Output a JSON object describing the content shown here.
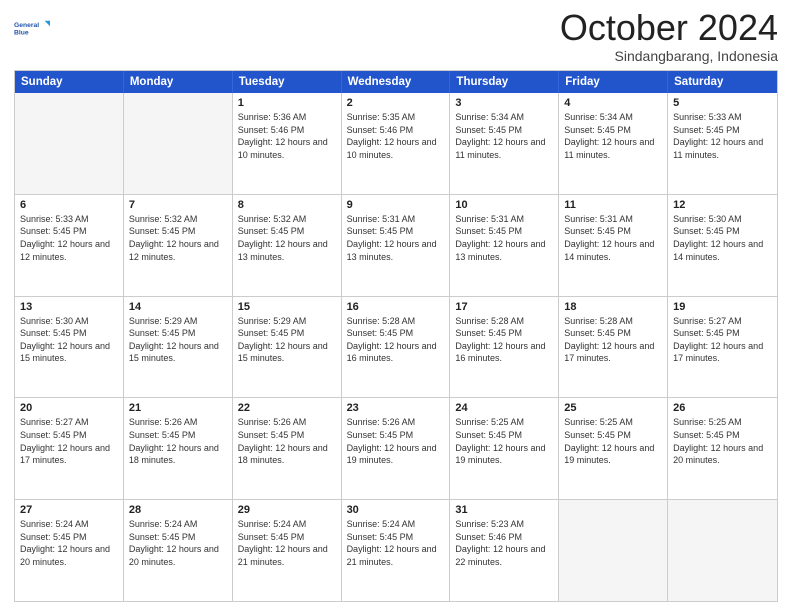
{
  "logo": {
    "line1": "General",
    "line2": "Blue"
  },
  "header": {
    "month": "October 2024",
    "location": "Sindangbarang, Indonesia"
  },
  "weekdays": [
    "Sunday",
    "Monday",
    "Tuesday",
    "Wednesday",
    "Thursday",
    "Friday",
    "Saturday"
  ],
  "rows": [
    [
      {
        "day": "",
        "sunrise": "",
        "sunset": "",
        "daylight": "",
        "empty": true
      },
      {
        "day": "",
        "sunrise": "",
        "sunset": "",
        "daylight": "",
        "empty": true
      },
      {
        "day": "1",
        "sunrise": "Sunrise: 5:36 AM",
        "sunset": "Sunset: 5:46 PM",
        "daylight": "Daylight: 12 hours and 10 minutes."
      },
      {
        "day": "2",
        "sunrise": "Sunrise: 5:35 AM",
        "sunset": "Sunset: 5:46 PM",
        "daylight": "Daylight: 12 hours and 10 minutes."
      },
      {
        "day": "3",
        "sunrise": "Sunrise: 5:34 AM",
        "sunset": "Sunset: 5:45 PM",
        "daylight": "Daylight: 12 hours and 11 minutes."
      },
      {
        "day": "4",
        "sunrise": "Sunrise: 5:34 AM",
        "sunset": "Sunset: 5:45 PM",
        "daylight": "Daylight: 12 hours and 11 minutes."
      },
      {
        "day": "5",
        "sunrise": "Sunrise: 5:33 AM",
        "sunset": "Sunset: 5:45 PM",
        "daylight": "Daylight: 12 hours and 11 minutes."
      }
    ],
    [
      {
        "day": "6",
        "sunrise": "Sunrise: 5:33 AM",
        "sunset": "Sunset: 5:45 PM",
        "daylight": "Daylight: 12 hours and 12 minutes."
      },
      {
        "day": "7",
        "sunrise": "Sunrise: 5:32 AM",
        "sunset": "Sunset: 5:45 PM",
        "daylight": "Daylight: 12 hours and 12 minutes."
      },
      {
        "day": "8",
        "sunrise": "Sunrise: 5:32 AM",
        "sunset": "Sunset: 5:45 PM",
        "daylight": "Daylight: 12 hours and 13 minutes."
      },
      {
        "day": "9",
        "sunrise": "Sunrise: 5:31 AM",
        "sunset": "Sunset: 5:45 PM",
        "daylight": "Daylight: 12 hours and 13 minutes."
      },
      {
        "day": "10",
        "sunrise": "Sunrise: 5:31 AM",
        "sunset": "Sunset: 5:45 PM",
        "daylight": "Daylight: 12 hours and 13 minutes."
      },
      {
        "day": "11",
        "sunrise": "Sunrise: 5:31 AM",
        "sunset": "Sunset: 5:45 PM",
        "daylight": "Daylight: 12 hours and 14 minutes."
      },
      {
        "day": "12",
        "sunrise": "Sunrise: 5:30 AM",
        "sunset": "Sunset: 5:45 PM",
        "daylight": "Daylight: 12 hours and 14 minutes."
      }
    ],
    [
      {
        "day": "13",
        "sunrise": "Sunrise: 5:30 AM",
        "sunset": "Sunset: 5:45 PM",
        "daylight": "Daylight: 12 hours and 15 minutes."
      },
      {
        "day": "14",
        "sunrise": "Sunrise: 5:29 AM",
        "sunset": "Sunset: 5:45 PM",
        "daylight": "Daylight: 12 hours and 15 minutes."
      },
      {
        "day": "15",
        "sunrise": "Sunrise: 5:29 AM",
        "sunset": "Sunset: 5:45 PM",
        "daylight": "Daylight: 12 hours and 15 minutes."
      },
      {
        "day": "16",
        "sunrise": "Sunrise: 5:28 AM",
        "sunset": "Sunset: 5:45 PM",
        "daylight": "Daylight: 12 hours and 16 minutes."
      },
      {
        "day": "17",
        "sunrise": "Sunrise: 5:28 AM",
        "sunset": "Sunset: 5:45 PM",
        "daylight": "Daylight: 12 hours and 16 minutes."
      },
      {
        "day": "18",
        "sunrise": "Sunrise: 5:28 AM",
        "sunset": "Sunset: 5:45 PM",
        "daylight": "Daylight: 12 hours and 17 minutes."
      },
      {
        "day": "19",
        "sunrise": "Sunrise: 5:27 AM",
        "sunset": "Sunset: 5:45 PM",
        "daylight": "Daylight: 12 hours and 17 minutes."
      }
    ],
    [
      {
        "day": "20",
        "sunrise": "Sunrise: 5:27 AM",
        "sunset": "Sunset: 5:45 PM",
        "daylight": "Daylight: 12 hours and 17 minutes."
      },
      {
        "day": "21",
        "sunrise": "Sunrise: 5:26 AM",
        "sunset": "Sunset: 5:45 PM",
        "daylight": "Daylight: 12 hours and 18 minutes."
      },
      {
        "day": "22",
        "sunrise": "Sunrise: 5:26 AM",
        "sunset": "Sunset: 5:45 PM",
        "daylight": "Daylight: 12 hours and 18 minutes."
      },
      {
        "day": "23",
        "sunrise": "Sunrise: 5:26 AM",
        "sunset": "Sunset: 5:45 PM",
        "daylight": "Daylight: 12 hours and 19 minutes."
      },
      {
        "day": "24",
        "sunrise": "Sunrise: 5:25 AM",
        "sunset": "Sunset: 5:45 PM",
        "daylight": "Daylight: 12 hours and 19 minutes."
      },
      {
        "day": "25",
        "sunrise": "Sunrise: 5:25 AM",
        "sunset": "Sunset: 5:45 PM",
        "daylight": "Daylight: 12 hours and 19 minutes."
      },
      {
        "day": "26",
        "sunrise": "Sunrise: 5:25 AM",
        "sunset": "Sunset: 5:45 PM",
        "daylight": "Daylight: 12 hours and 20 minutes."
      }
    ],
    [
      {
        "day": "27",
        "sunrise": "Sunrise: 5:24 AM",
        "sunset": "Sunset: 5:45 PM",
        "daylight": "Daylight: 12 hours and 20 minutes."
      },
      {
        "day": "28",
        "sunrise": "Sunrise: 5:24 AM",
        "sunset": "Sunset: 5:45 PM",
        "daylight": "Daylight: 12 hours and 20 minutes."
      },
      {
        "day": "29",
        "sunrise": "Sunrise: 5:24 AM",
        "sunset": "Sunset: 5:45 PM",
        "daylight": "Daylight: 12 hours and 21 minutes."
      },
      {
        "day": "30",
        "sunrise": "Sunrise: 5:24 AM",
        "sunset": "Sunset: 5:45 PM",
        "daylight": "Daylight: 12 hours and 21 minutes."
      },
      {
        "day": "31",
        "sunrise": "Sunrise: 5:23 AM",
        "sunset": "Sunset: 5:46 PM",
        "daylight": "Daylight: 12 hours and 22 minutes."
      },
      {
        "day": "",
        "sunrise": "",
        "sunset": "",
        "daylight": "",
        "empty": true
      },
      {
        "day": "",
        "sunrise": "",
        "sunset": "",
        "daylight": "",
        "empty": true
      }
    ]
  ]
}
